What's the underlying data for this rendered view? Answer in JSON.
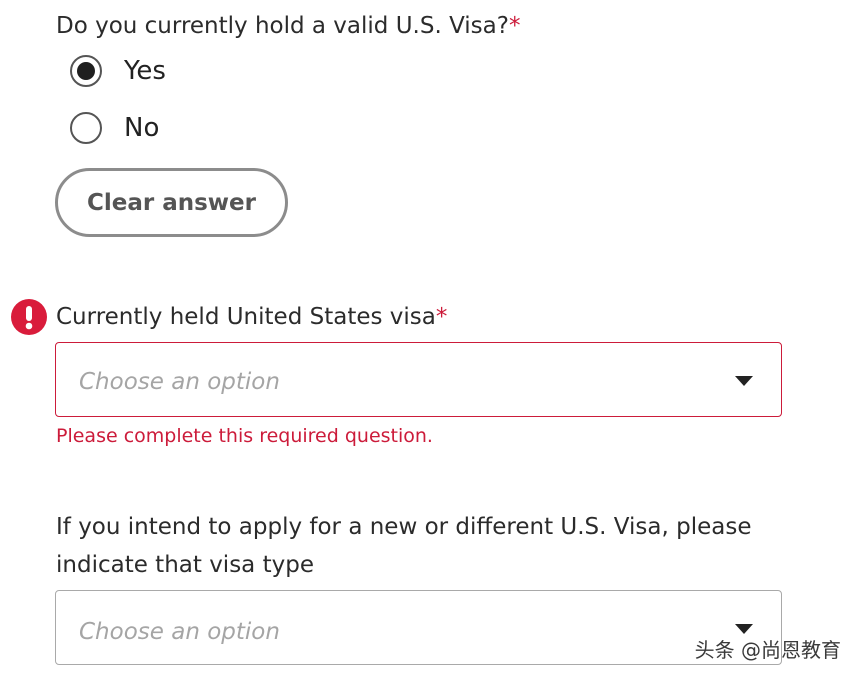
{
  "question1": {
    "label": "Do you currently hold a valid U.S. Visa?",
    "required_mark": "*",
    "options": [
      {
        "label": "Yes",
        "selected": true
      },
      {
        "label": "No",
        "selected": false
      }
    ],
    "clear_label": "Clear answer"
  },
  "question2": {
    "label": "Currently held United States visa",
    "required_mark": "*",
    "placeholder": "Choose an option",
    "error_message": "Please complete this required question."
  },
  "question3": {
    "label": "If you intend to apply for a new or different U.S. Visa, please indicate that visa type",
    "placeholder": "Choose an option"
  },
  "watermark": {
    "text": "头条 @尚恩教育"
  },
  "colors": {
    "error": "#cc1b3a",
    "error_icon": "#d91c3b",
    "placeholder": "#a5a5a5",
    "border_normal": "#a9a9a9"
  },
  "icons": {
    "error": "exclamation-circle-icon",
    "select": "caret-down-icon"
  }
}
